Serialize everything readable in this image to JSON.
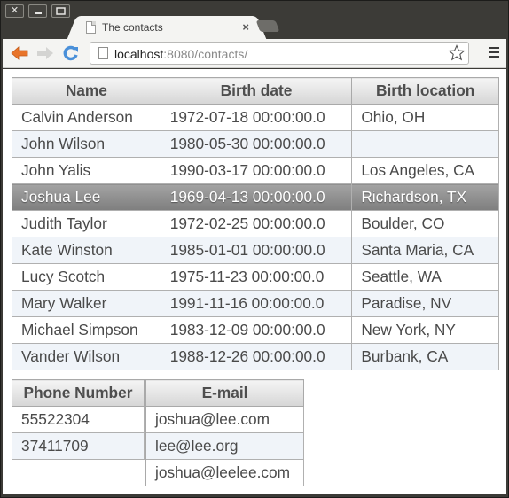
{
  "window": {
    "controls": [
      {
        "name": "close",
        "glyph": "✕"
      },
      {
        "name": "minimize",
        "glyph": "—"
      },
      {
        "name": "maximize",
        "glyph": "▢"
      }
    ]
  },
  "tab": {
    "title": "The contacts",
    "close_glyph": "×"
  },
  "toolbar": {
    "url_host": "localhost",
    "url_rest": ":8080/contacts/",
    "accent_back": "#e8742a",
    "accent_reload": "#4a90d9"
  },
  "contacts": {
    "headers": [
      "Name",
      "Birth date",
      "Birth location"
    ],
    "rows": [
      {
        "name": "Calvin Anderson",
        "birth_date": "1972-07-18 00:00:00.0",
        "birth_location": "Ohio, OH",
        "selected": false
      },
      {
        "name": "John Wilson",
        "birth_date": "1980-05-30 00:00:00.0",
        "birth_location": "",
        "selected": false
      },
      {
        "name": "John Yalis",
        "birth_date": "1990-03-17 00:00:00.0",
        "birth_location": "Los Angeles, CA",
        "selected": false
      },
      {
        "name": "Joshua Lee",
        "birth_date": "1969-04-13 00:00:00.0",
        "birth_location": "Richardson, TX",
        "selected": true
      },
      {
        "name": "Judith Taylor",
        "birth_date": "1972-02-25 00:00:00.0",
        "birth_location": "Boulder, CO",
        "selected": false
      },
      {
        "name": "Kate Winston",
        "birth_date": "1985-01-01 00:00:00.0",
        "birth_location": "Santa Maria, CA",
        "selected": false
      },
      {
        "name": "Lucy Scotch",
        "birth_date": "1975-11-23 00:00:00.0",
        "birth_location": "Seattle, WA",
        "selected": false
      },
      {
        "name": "Mary Walker",
        "birth_date": "1991-11-16 00:00:00.0",
        "birth_location": "Paradise, NV",
        "selected": false
      },
      {
        "name": "Michael Simpson",
        "birth_date": "1983-12-09 00:00:00.0",
        "birth_location": "New York, NY",
        "selected": false
      },
      {
        "name": "Vander Wilson",
        "birth_date": "1988-12-26 00:00:00.0",
        "birth_location": "Burbank, CA",
        "selected": false
      }
    ]
  },
  "phones": {
    "header": "Phone Number",
    "rows": [
      "55522304",
      "37411709"
    ]
  },
  "emails": {
    "header": "E-mail",
    "rows": [
      "joshua@lee.com",
      "lee@lee.org",
      "joshua@leelee.com"
    ]
  }
}
